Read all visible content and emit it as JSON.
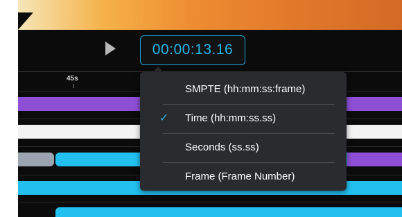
{
  "player": {
    "timecode": "00:00:13.16"
  },
  "ruler": {
    "label": "45s"
  },
  "format_menu": {
    "items": [
      {
        "label": "SMPTE (hh:mm:ss:frame)",
        "selected": false
      },
      {
        "label": "Time (hh:mm:ss.ss)",
        "selected": true,
        "check": "✓"
      },
      {
        "label": "Seconds (ss.ss)",
        "selected": false
      },
      {
        "label": "Frame (Frame Number)",
        "selected": false
      }
    ]
  },
  "colors": {
    "accent": "#22c0ef",
    "track_purple": "#8e4fd6",
    "track_white": "#f2f2f2",
    "track_gray": "#9aa5b1",
    "menu_bg": "#2a2b2f"
  }
}
